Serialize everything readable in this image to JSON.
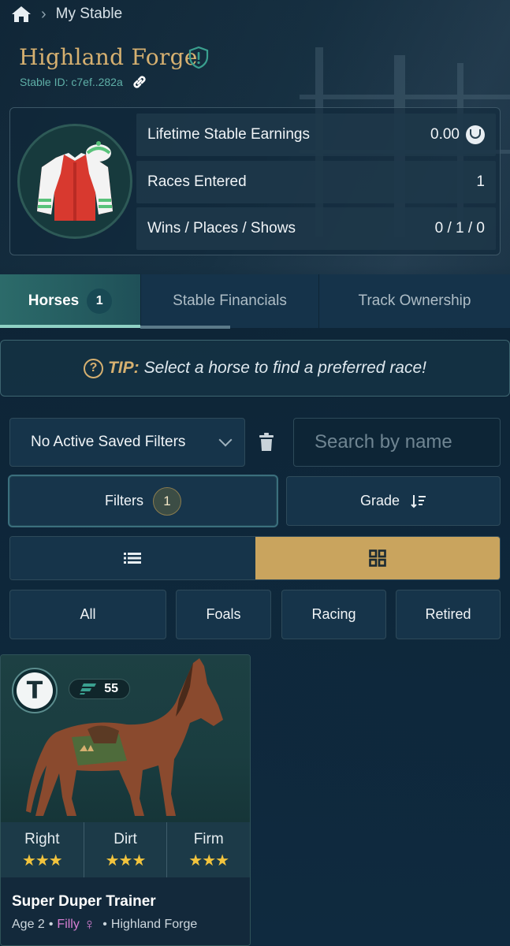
{
  "breadcrumb": {
    "home_icon": "home-icon",
    "current": "My Stable"
  },
  "stable": {
    "name": "Highland Forge",
    "id_label": "Stable ID: c7ef..282a"
  },
  "stats": [
    {
      "label": "Lifetime Stable Earnings",
      "value": "0.00",
      "icon": "coin-icon"
    },
    {
      "label": "Races Entered",
      "value": "1"
    },
    {
      "label": "Wins / Places / Shows",
      "value": "0 / 1 / 0"
    }
  ],
  "tabs": [
    {
      "label": "Horses",
      "badge": "1",
      "active": true
    },
    {
      "label": "Stable Financials"
    },
    {
      "label": "Track Ownership"
    }
  ],
  "tip": {
    "label": "TIP:",
    "text": "Select a horse to find a preferred race!"
  },
  "filters": {
    "saved_filter_value": "No Active Saved Filters",
    "search_placeholder": "Search by name",
    "filters_label": "Filters",
    "filters_count": "1",
    "sort_label": "Grade",
    "view_mode": "grid",
    "categories": [
      "All",
      "Foals",
      "Racing",
      "Retired"
    ]
  },
  "horse_card": {
    "trainer_initial": "T",
    "rating": "55",
    "surfaces": [
      {
        "label": "Right",
        "stars": "★★★",
        "rating": 3
      },
      {
        "label": "Dirt",
        "stars": "★★★",
        "rating": 3
      },
      {
        "label": "Firm",
        "stars": "★★★",
        "rating": 3
      }
    ],
    "name": "Super Duper Trainer",
    "age": "Age 2",
    "sex": "Filly",
    "sex_symbol": "♀",
    "stable": "Highland Forge"
  },
  "colors": {
    "accent_gold": "#d6b070",
    "active_tab": "#2c6b6a",
    "star": "#f2c43d",
    "filly": "#d77fd3"
  }
}
